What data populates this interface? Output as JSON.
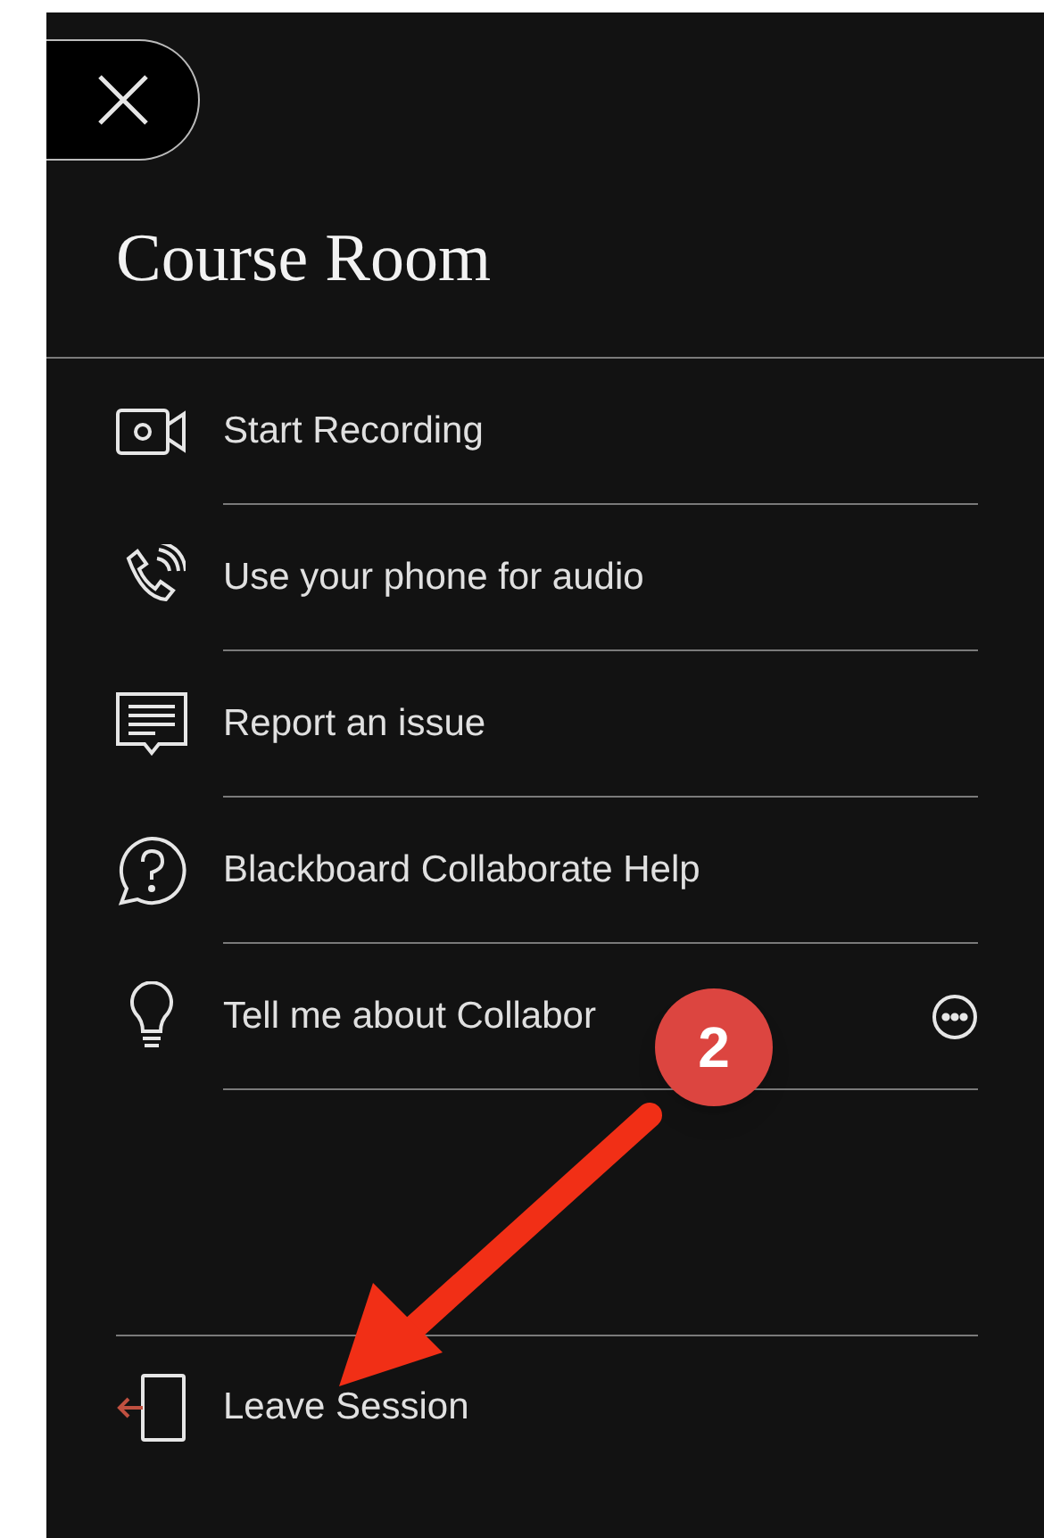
{
  "panel": {
    "title": "Course Room"
  },
  "menu": [
    {
      "label": "Start Recording",
      "more": false
    },
    {
      "label": "Use your phone for audio",
      "more": false
    },
    {
      "label": "Report an issue",
      "more": false
    },
    {
      "label": "Blackboard Collaborate Help",
      "more": false
    },
    {
      "label": "Tell me about Collabor",
      "more": true
    }
  ],
  "footer": {
    "label": "Leave Session"
  },
  "annotation": {
    "badge": "2"
  }
}
